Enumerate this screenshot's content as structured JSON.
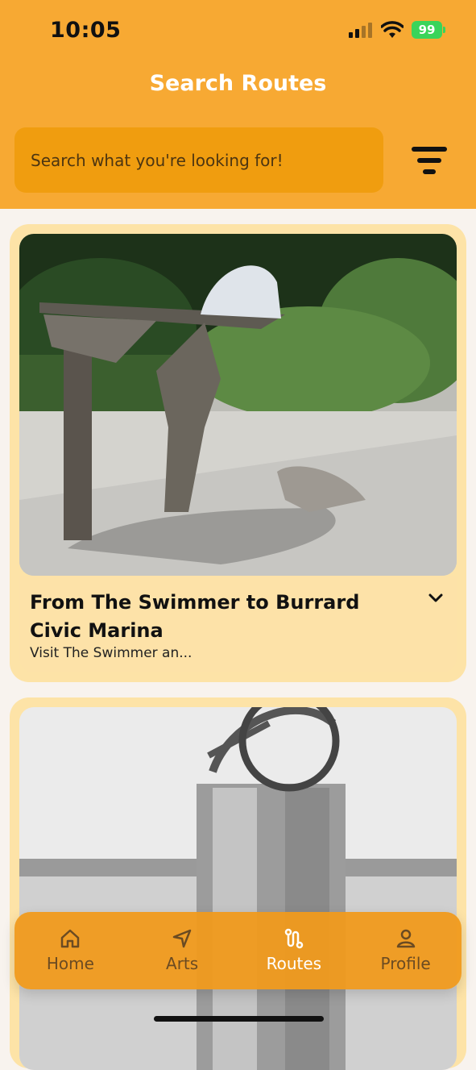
{
  "status_bar": {
    "time": "10:05",
    "battery": "99"
  },
  "header": {
    "title": "Search Routes"
  },
  "search": {
    "placeholder": "Search what you're looking for!",
    "value": ""
  },
  "filter": {
    "icon": "filter-icon"
  },
  "routes": [
    {
      "title": "From The Swimmer to Burrard Civic Marina",
      "subtitle": "Visit The Swimmer an...",
      "image": "bent metal sculpture in sunny plaza"
    },
    {
      "title": "",
      "subtitle": "",
      "image": "black-and-white sculpture with ring on pillar"
    }
  ],
  "nav": {
    "items": [
      {
        "label": "Home",
        "icon": "home-icon"
      },
      {
        "label": "Arts",
        "icon": "navigation-arrow-icon"
      },
      {
        "label": "Routes",
        "icon": "route-icon"
      },
      {
        "label": "Profile",
        "icon": "user-icon"
      }
    ],
    "active": "Routes"
  },
  "colors": {
    "header": "#f7a933",
    "search": "#f09d0f",
    "card": "#fde3a7",
    "nav": "#f09a1c",
    "active": "#ffffff"
  }
}
